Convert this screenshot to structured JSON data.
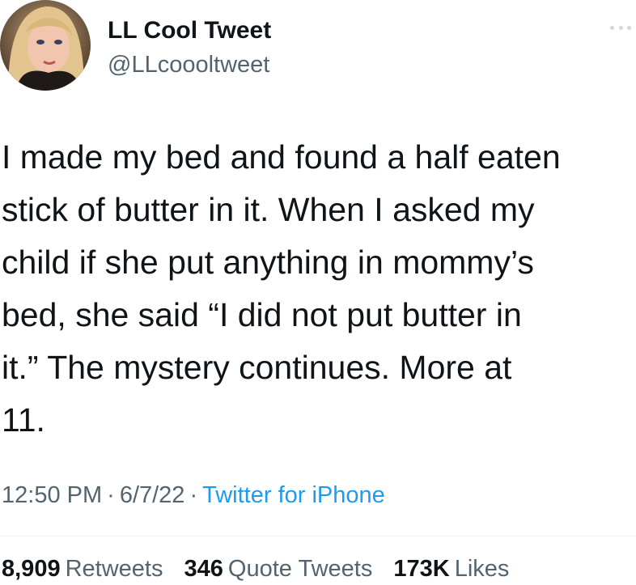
{
  "author": {
    "display_name": "LL Cool Tweet",
    "handle": "@LLcoooltweet",
    "avatar_icon": "profile-photo"
  },
  "tweet": {
    "text": "I made my bed and found a half eaten\nstick of butter in it. When I asked my\nchild if she put anything in mommy’s\nbed, she said “I did not put butter in\nit.” The mystery continues. More at\n11."
  },
  "meta": {
    "time": "12:50 PM",
    "separator": "·",
    "date": "6/7/22",
    "source": "Twitter for iPhone"
  },
  "stats": {
    "retweets_count": "8,909",
    "retweets_label": "Retweets",
    "quotes_count": "346",
    "quotes_label": "Quote Tweets",
    "likes_count": "173K",
    "likes_label": "Likes"
  },
  "colors": {
    "text": "#0f1419",
    "secondary": "#536471",
    "link": "#1d9bf0",
    "divider": "#eff3f4"
  }
}
